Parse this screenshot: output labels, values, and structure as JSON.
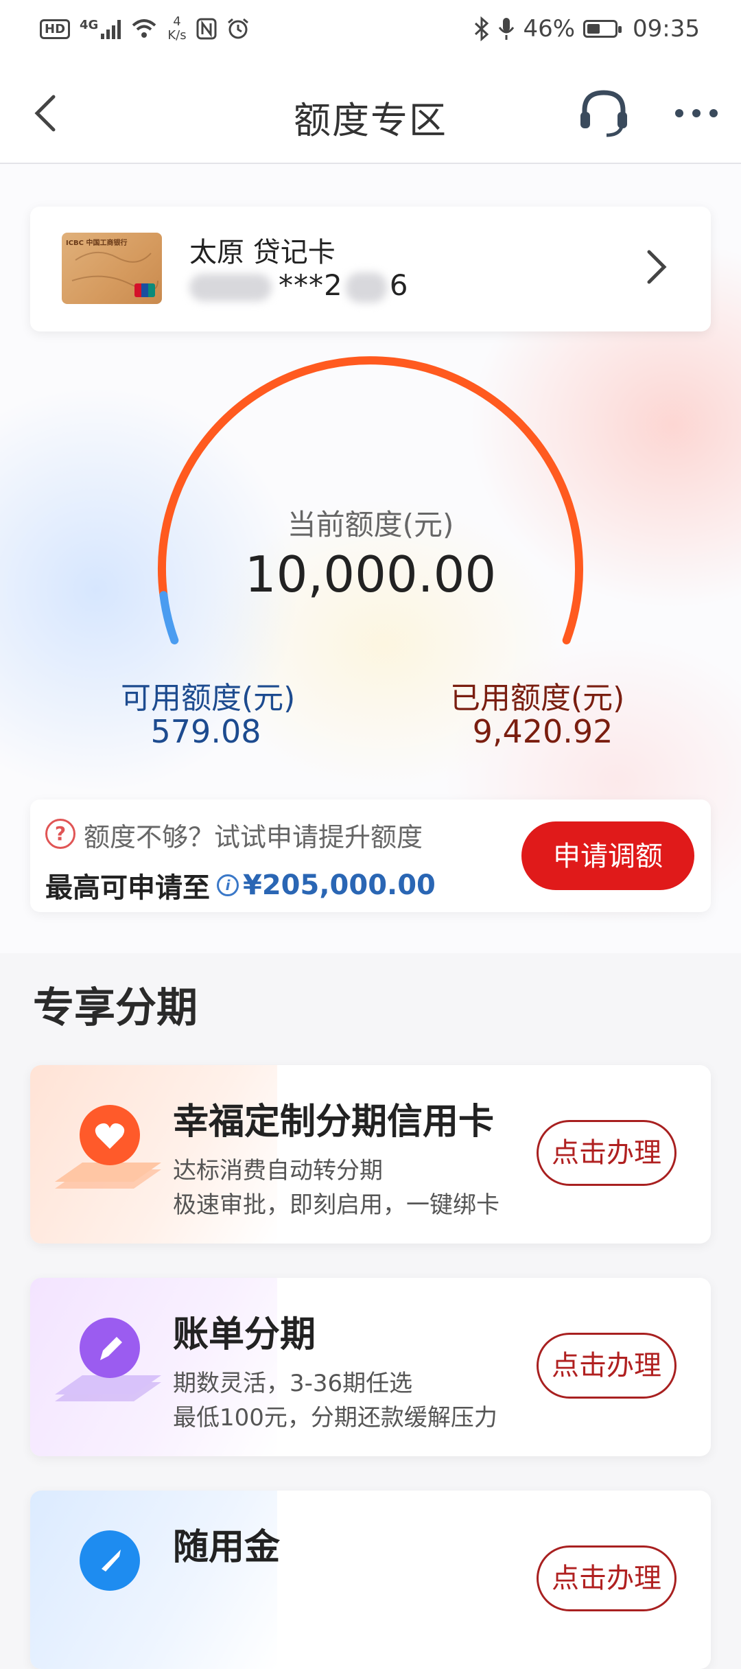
{
  "status_bar": {
    "hd": "HD",
    "network": "4G",
    "speed_value": "4",
    "speed_unit": "K/s",
    "battery": "46%",
    "time": "09:35"
  },
  "nav": {
    "title": "额度专区"
  },
  "card": {
    "name": "太原 贷记卡",
    "number_visible_mid": "***2",
    "number_visible_end": "6",
    "brand": "ICBC 中国工商银行"
  },
  "gauge": {
    "current_label": "当前额度(元)",
    "current_value": "10,000.00",
    "available_fraction": 0.058,
    "colors": {
      "used": "#ff5a1f",
      "available": "#4a9cf0"
    }
  },
  "available": {
    "label": "可用额度(元)",
    "value": "579.08"
  },
  "used": {
    "label": "已用额度(元)",
    "value": "9,420.92"
  },
  "raise": {
    "hint": "额度不够？试试申请提升额度",
    "max_label": "最高可申请至",
    "max_amount": "¥205,000.00",
    "button": "申请调额"
  },
  "section": {
    "title": "专享分期"
  },
  "products": [
    {
      "title": "幸福定制分期信用卡",
      "desc1": "达标消费自动转分期",
      "desc2": "极速审批，即刻启用，一键绑卡",
      "button": "点击办理",
      "icon": "heart-icon"
    },
    {
      "title": "账单分期",
      "desc1": "期数灵活，3-36期任选",
      "desc2": "最低100元，分期还款缓解压力",
      "button": "点击办理",
      "icon": "pencil-icon"
    },
    {
      "title": "随用金",
      "desc1": "",
      "desc2": "",
      "button": "点击办理",
      "icon": "rocket-icon"
    }
  ]
}
